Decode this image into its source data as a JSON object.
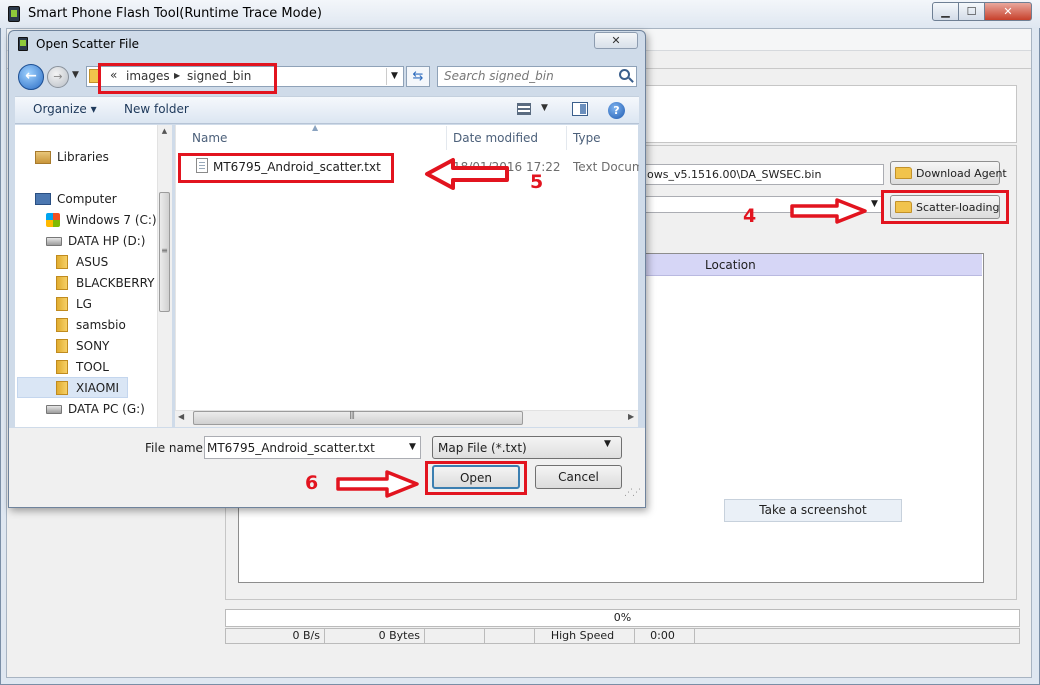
{
  "app": {
    "title": "Smart Phone Flash Tool(Runtime Trace Mode)",
    "download_agent_path": "ows_v5.1516.00\\DA_SWSEC.bin",
    "download_agent_label": "Download Agent",
    "scatter_loading_label": "Scatter-loading",
    "table_column_location": "Location",
    "screenshot_label": "Take a screenshot",
    "progress_text": "0%",
    "status": {
      "speed": "0 B/s",
      "bytes": "0 Bytes",
      "mode": "High Speed",
      "time": "0:00"
    }
  },
  "dialog": {
    "title": "Open Scatter File",
    "breadcrumb": {
      "chevron": "«",
      "parts": [
        "images",
        "signed_bin"
      ]
    },
    "search_placeholder": "Search signed_bin",
    "organize_label": "Organize ▾",
    "new_folder_label": "New folder",
    "nav_items": [
      {
        "label": "Libraries",
        "kind": "libraries"
      },
      {
        "label": "Computer",
        "kind": "computer"
      },
      {
        "label": "Windows 7 (C:)",
        "kind": "windows-drive"
      },
      {
        "label": "DATA HP (D:)",
        "kind": "drive"
      },
      {
        "label": "ASUS",
        "kind": "folder"
      },
      {
        "label": "BLACKBERRY",
        "kind": "folder"
      },
      {
        "label": "LG",
        "kind": "folder"
      },
      {
        "label": "samsbio",
        "kind": "folder"
      },
      {
        "label": "SONY",
        "kind": "folder"
      },
      {
        "label": "TOOL",
        "kind": "folder"
      },
      {
        "label": "XIAOMI",
        "kind": "folder",
        "selected": true
      },
      {
        "label": "DATA PC (G:)",
        "kind": "drive"
      }
    ],
    "columns": [
      "Name",
      "Date modified",
      "Type"
    ],
    "files": [
      {
        "name": "MT6795_Android_scatter.txt",
        "date": "18/01/2016 17:22",
        "type": "Text Document"
      }
    ],
    "file_name_label": "File name:",
    "file_name_value": "MT6795_Android_scatter.txt",
    "file_type_value": "Map File (*.txt)",
    "open_label": "Open",
    "cancel_label": "Cancel"
  },
  "annotations": {
    "step_scatter": "4",
    "step_file": "5",
    "step_open": "6",
    "color": "#e2141f"
  }
}
